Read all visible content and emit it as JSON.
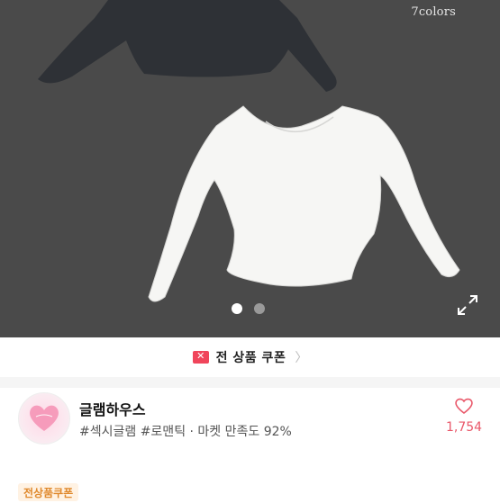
{
  "hero": {
    "colors_label": "7colors",
    "carousel": {
      "slide_count": 2,
      "active_index": 0
    }
  },
  "coupon": {
    "label": "전 상품 쿠폰",
    "accent": "#f0455b"
  },
  "shop": {
    "name": "글램하우스",
    "tags": "#섹시글램 #로맨틱 · 마켓 만족도 92%",
    "likes": "1,754",
    "like_color": "#e9586a"
  },
  "promo_badge": "전상품쿠폰"
}
